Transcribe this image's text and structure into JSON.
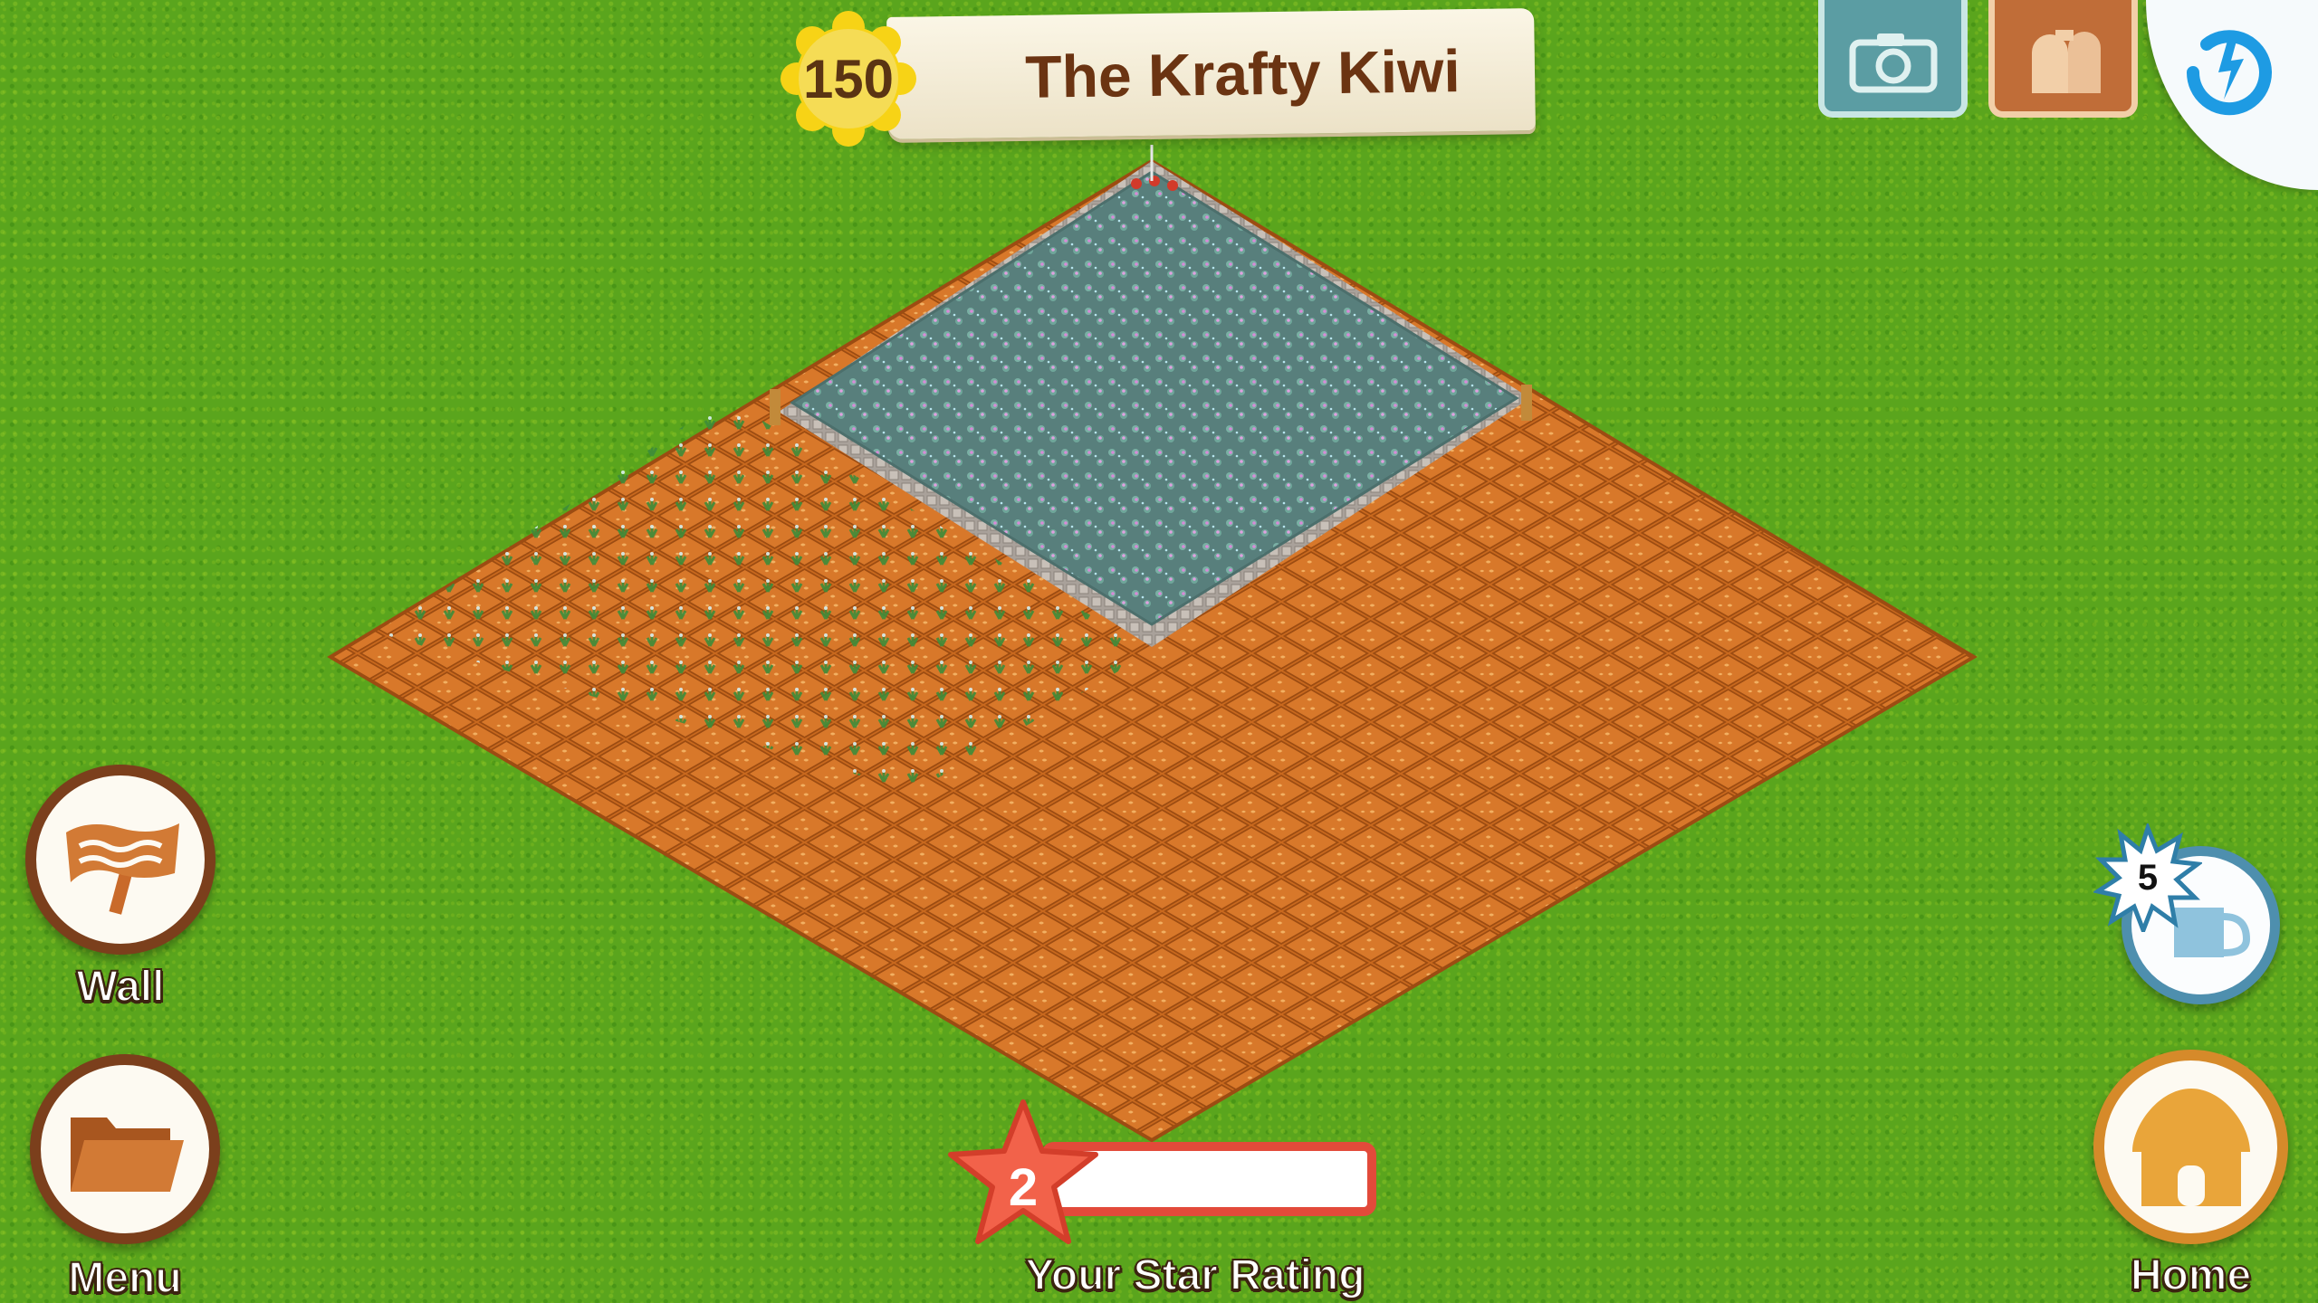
{
  "header": {
    "coins": "150",
    "farm_name": "The Krafty Kiwi"
  },
  "toolbar": {
    "camera_icon": "camera-icon",
    "mailbox_icon": "mailbox-icon",
    "sync_icon": "sync-icon"
  },
  "left_buttons": {
    "wall_label": "Wall",
    "menu_label": "Menu"
  },
  "right_buttons": {
    "watering_count": "5",
    "home_label": "Home"
  },
  "star_rating": {
    "level": "2",
    "progress": 0.0,
    "caption": "Your Star Rating"
  },
  "colors": {
    "grass": "#5aa51d",
    "soil": "#c9691e",
    "flower_field": "#5d8e87",
    "banner_text": "#6b3412",
    "rating_red": "#e24a3a"
  }
}
